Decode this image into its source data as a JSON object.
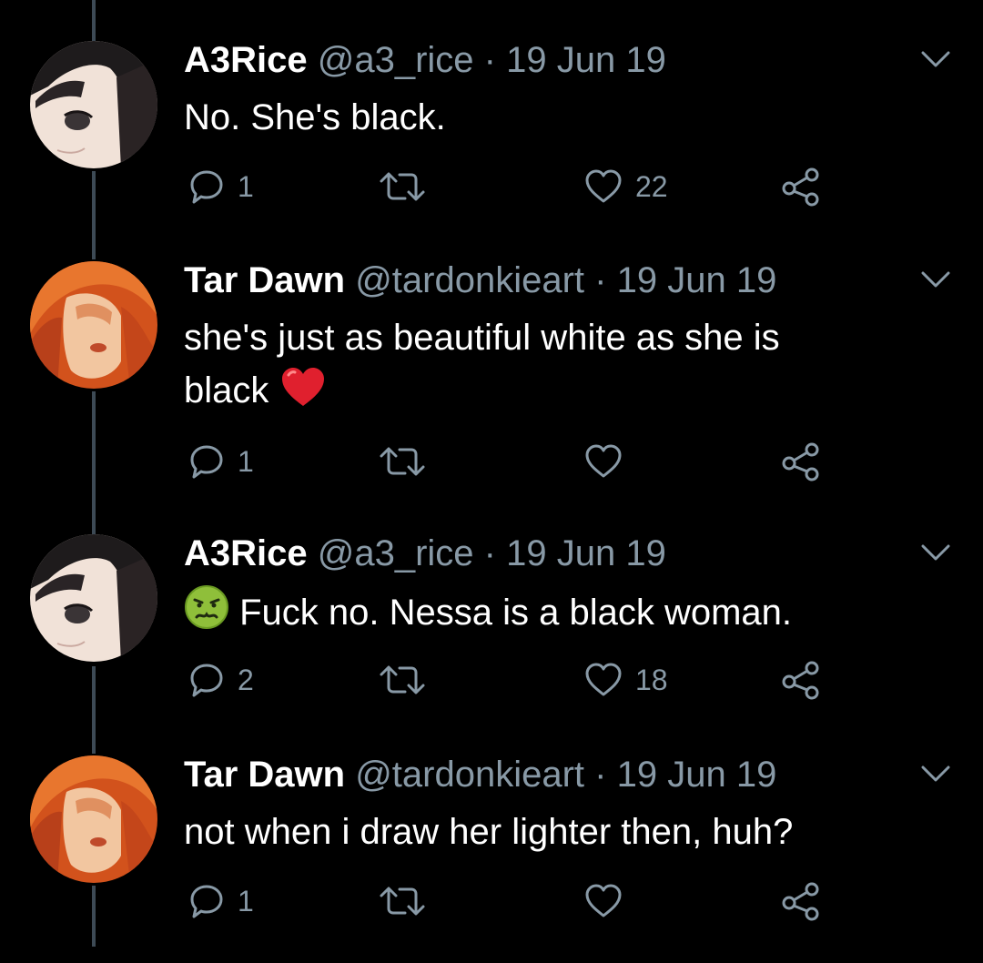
{
  "colors": {
    "background": "#000000",
    "thread_line": "#3d4a55",
    "secondary_text": "#8899a6",
    "primary_text": "#ffffff",
    "heart_emoji": "#e0202e"
  },
  "tweets": [
    {
      "name": "A3Rice",
      "handle": "@a3_rice",
      "separator": "·",
      "date": "19 Jun 19",
      "text_lines": [
        "No. She's black."
      ],
      "leading_emoji": "",
      "trailing_emoji": "",
      "replies": "1",
      "retweets": "",
      "likes": "22",
      "avatar_icon": "anime-girl-avatar"
    },
    {
      "name": "Tar Dawn",
      "handle": "@tardonkieart",
      "separator": "·",
      "date": "19 Jun 19",
      "text_lines": [
        "she's just as beautiful white as she is",
        "black"
      ],
      "leading_emoji": "",
      "trailing_emoji": "red-heart-emoji",
      "replies": "1",
      "retweets": "",
      "likes": "",
      "avatar_icon": "orange-portrait-avatar"
    },
    {
      "name": "A3Rice",
      "handle": "@a3_rice",
      "separator": "·",
      "date": "19 Jun 19",
      "text_lines": [
        "Fuck no. Nessa is a black woman."
      ],
      "leading_emoji": "nauseated-face-emoji",
      "trailing_emoji": "",
      "replies": "2",
      "retweets": "",
      "likes": "18",
      "avatar_icon": "anime-girl-avatar"
    },
    {
      "name": "Tar Dawn",
      "handle": "@tardonkieart",
      "separator": "·",
      "date": "19 Jun 19",
      "text_lines": [
        "not when i draw her lighter then, huh?"
      ],
      "leading_emoji": "",
      "trailing_emoji": "",
      "replies": "1",
      "retweets": "",
      "likes": "",
      "avatar_icon": "orange-portrait-avatar"
    }
  ]
}
